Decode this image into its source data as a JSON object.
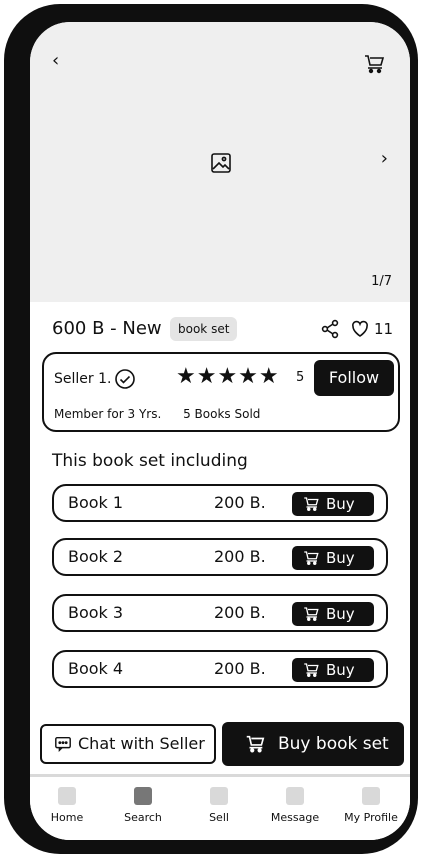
{
  "hero": {
    "back_icon": "chevron-left-icon",
    "cart_icon": "cart-icon",
    "image_icon": "image-placeholder-icon",
    "next_icon": "chevron-right-icon",
    "page_indicator": "1/7"
  },
  "listing": {
    "price_title": "600 B - New",
    "tag": "book set",
    "like_count": "11"
  },
  "seller": {
    "name": "Seller 1.",
    "stars": "★★★★★",
    "rating": "5",
    "follow_label": "Follow",
    "member_for": "Member for 3 Yrs.",
    "books_sold": "5 Books Sold"
  },
  "set_section_title": "This book set including",
  "books": [
    {
      "name": "Book 1",
      "price": "200 B.",
      "buy_label": "Buy"
    },
    {
      "name": "Book 2",
      "price": "200 B.",
      "buy_label": "Buy"
    },
    {
      "name": "Book 3",
      "price": "200 B.",
      "buy_label": "Buy"
    },
    {
      "name": "Book 4",
      "price": "200 B.",
      "buy_label": "Buy"
    }
  ],
  "actions": {
    "chat_label": "Chat with Seller",
    "buy_set_label": "Buy book set"
  },
  "nav": [
    {
      "label": "Home",
      "active": false
    },
    {
      "label": "Search",
      "active": true
    },
    {
      "label": "Sell",
      "active": false
    },
    {
      "label": "Message",
      "active": false
    },
    {
      "label": "My Profile",
      "active": false
    }
  ],
  "colors": {
    "primary": "#111111",
    "hero_bg": "#efefef",
    "nav_inactive": "#d9d9d9",
    "nav_active": "#777777"
  }
}
